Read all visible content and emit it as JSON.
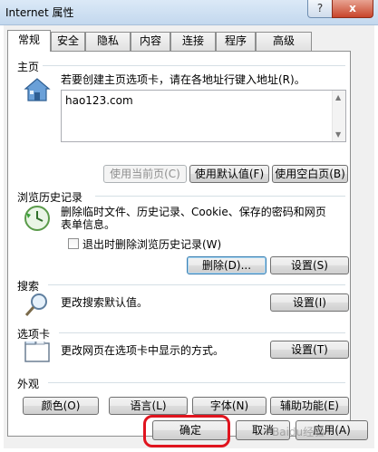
{
  "window": {
    "title": "Internet 属性",
    "help_label": "?",
    "close_label": "x"
  },
  "tabs": [
    "常规",
    "安全",
    "隐私",
    "内容",
    "连接",
    "程序",
    "高级"
  ],
  "homepage": {
    "group_title": "主页",
    "description": "若要创建主页选项卡，请在各地址行键入地址(R)。",
    "url": "hao123.com",
    "use_current": "使用当前页(C)",
    "use_default": "使用默认值(F)",
    "use_blank": "使用空白页(B)"
  },
  "history": {
    "group_title": "浏览历史记录",
    "description_line1": "删除临时文件、历史记录、Cookie、保存的密码和网页",
    "description_line2": "表单信息。",
    "checkbox_label": "退出时删除浏览历史记录(W)",
    "checkbox_checked": false,
    "delete_label": "删除(D)...",
    "settings_label": "设置(S)"
  },
  "search": {
    "group_title": "搜索",
    "description": "更改搜索默认值。",
    "settings_label": "设置(I)"
  },
  "tabs_group": {
    "group_title": "选项卡",
    "description": "更改网页在选项卡中显示的方式。",
    "settings_label": "设置(T)"
  },
  "appearance": {
    "group_title": "外观",
    "colors": "颜色(O)",
    "languages": "语言(L)",
    "fonts": "字体(N)",
    "accessibility": "辅助功能(E)"
  },
  "dialog_buttons": {
    "ok": "确定",
    "cancel": "取消",
    "apply": "应用(A)"
  },
  "watermark": "Baidu经验",
  "colors": {
    "highlight": "#e0141e",
    "titlebar": "#c3d8ee"
  }
}
